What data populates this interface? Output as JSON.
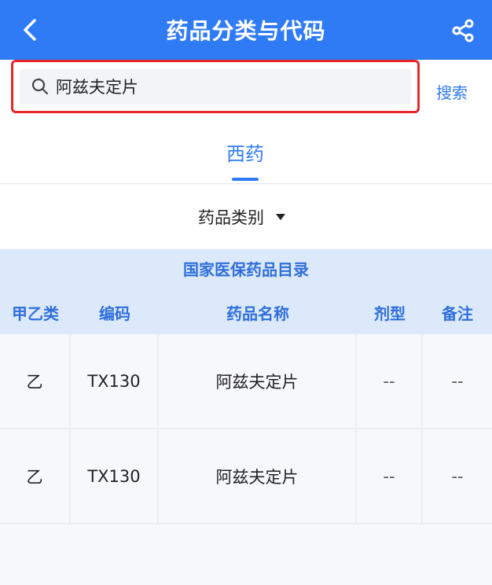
{
  "header": {
    "title": "药品分类与代码",
    "back_icon": "chevron-left-icon",
    "share_icon": "share-icon"
  },
  "search": {
    "value": "阿兹夫定片",
    "icon": "search-icon",
    "button_label": "搜索"
  },
  "tabs": [
    {
      "label": "西药",
      "active": true
    }
  ],
  "category": {
    "label": "药品类别",
    "icon": "caret-down-icon"
  },
  "table": {
    "title": "国家医保药品目录",
    "columns": [
      "甲乙类",
      "编码",
      "药品名称",
      "剂型",
      "备注"
    ],
    "rows": [
      [
        "乙",
        "TX130",
        "阿兹夫定片",
        "--",
        "--"
      ],
      [
        "乙",
        "TX130",
        "阿兹夫定片",
        "--",
        "--"
      ]
    ]
  },
  "colors": {
    "primary": "#2f7bf6",
    "table_header_bg": "#dce9fb",
    "highlight_border": "#e8262b"
  }
}
